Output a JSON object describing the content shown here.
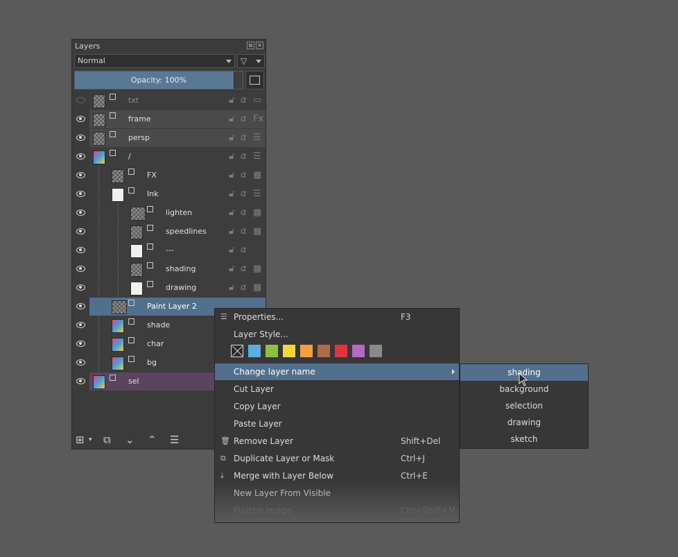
{
  "panel": {
    "title": "Layers",
    "blend_mode": "Normal",
    "opacity_label": "Opacity:  100%"
  },
  "layers": [
    {
      "name": "txt",
      "state": "dim"
    },
    {
      "name": "frame",
      "state": "grey"
    },
    {
      "name": "persp",
      "state": "grey"
    },
    {
      "name": "/",
      "state": "normal"
    },
    {
      "name": "FX",
      "state": "normal"
    },
    {
      "name": "Ink",
      "state": "normal"
    },
    {
      "name": "lighten",
      "state": "normal"
    },
    {
      "name": "speedlines",
      "state": "normal"
    },
    {
      "name": "---",
      "state": "normal"
    },
    {
      "name": "shading",
      "state": "normal"
    },
    {
      "name": "drawing",
      "state": "normal"
    },
    {
      "name": "Paint Layer 2",
      "state": "selected"
    },
    {
      "name": "shade",
      "state": "normal"
    },
    {
      "name": "char",
      "state": "normal"
    },
    {
      "name": "bg",
      "state": "normal"
    },
    {
      "name": "sel",
      "state": "purple"
    }
  ],
  "menu": {
    "properties": {
      "label": "Properties...",
      "shortcut": "F3"
    },
    "layer_style": {
      "label": "Layer Style..."
    },
    "change_name": {
      "label": "Change layer name"
    },
    "cut": {
      "label": "Cut Layer"
    },
    "copy": {
      "label": "Copy Layer"
    },
    "paste": {
      "label": "Paste Layer"
    },
    "remove": {
      "label": "Remove Layer",
      "shortcut": "Shift+Del"
    },
    "duplicate": {
      "label": "Duplicate Layer or Mask",
      "shortcut": "Ctrl+J"
    },
    "merge": {
      "label": "Merge with Layer Below",
      "shortcut": "Ctrl+E"
    },
    "new_visible": {
      "label": "New Layer From Visible"
    },
    "flatten": {
      "label": "Flatten image",
      "shortcut": "Ctrl+Shift+M"
    },
    "color_labels": [
      "#5aaee0",
      "#8fbf3f",
      "#f0d83a",
      "#f0a040",
      "#b06a44",
      "#e0343a",
      "#b866c8",
      "#8a8a8a"
    ]
  },
  "submenu": [
    "shading",
    "background",
    "selection",
    "drawing",
    "sketch"
  ]
}
